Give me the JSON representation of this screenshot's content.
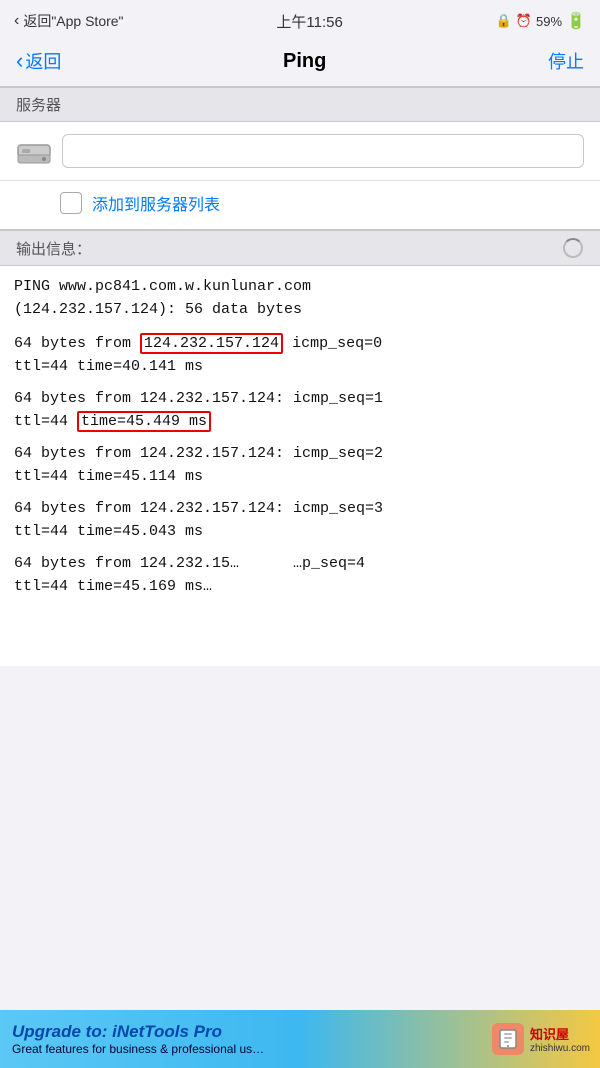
{
  "statusBar": {
    "back_label": "返回\"App Store\"",
    "time": "上午11:56",
    "lock_icon": "🔒",
    "alarm_icon": "⏰",
    "battery_percent": "59%"
  },
  "navBar": {
    "back_label": "返回",
    "title": "Ping",
    "stop_label": "停止"
  },
  "serverSection": {
    "header": "服务器",
    "input_placeholder": "",
    "checkbox_label": "添加到服务器列表"
  },
  "outputSection": {
    "header": "输出信息：",
    "intro_line1": "PING www.pc841.com.w.kunlunar.com",
    "intro_line2": "(124.232.157.124): 56 data bytes",
    "results": [
      {
        "line1_prefix": "64 bytes from ",
        "line1_ip": "124.232.157.124",
        "line1_suffix": " icmp_seq=0",
        "line2": "ttl=44 time=40.141 ms",
        "highlight_ip": true,
        "highlight_time": false
      },
      {
        "line1_prefix": "64 bytes from 124.232.157.124: icmp_seq=1",
        "line1_ip": "",
        "line1_suffix": "",
        "line2_prefix": "ttl=44 ",
        "line2_time": "time=45.449 ms",
        "highlight_ip": false,
        "highlight_time": true
      },
      {
        "line1": "64 bytes from 124.232.157.124: icmp_seq=2",
        "line2": "ttl=44 time=45.114 ms",
        "highlight_ip": false,
        "highlight_time": false
      },
      {
        "line1": "64 bytes from 124.232.157.124: icmp_seq=3",
        "line2": "ttl=44 time=45.043 ms",
        "highlight_ip": false,
        "highlight_time": false
      },
      {
        "line1": "64 bytes from 124.232.15…      …p_seq=4",
        "line2": "ttl=44 time=45.169 ms…",
        "highlight_ip": false,
        "highlight_time": false
      }
    ]
  },
  "adBanner": {
    "title_prefix": "Upgrade to: ",
    "title_app": "iNetTools Pro",
    "subtitle": "Great features for business & professional us…",
    "badge_icon": "📱",
    "badge_text_line1": "知识屋",
    "badge_text_line2": "zhishiwu.com"
  }
}
